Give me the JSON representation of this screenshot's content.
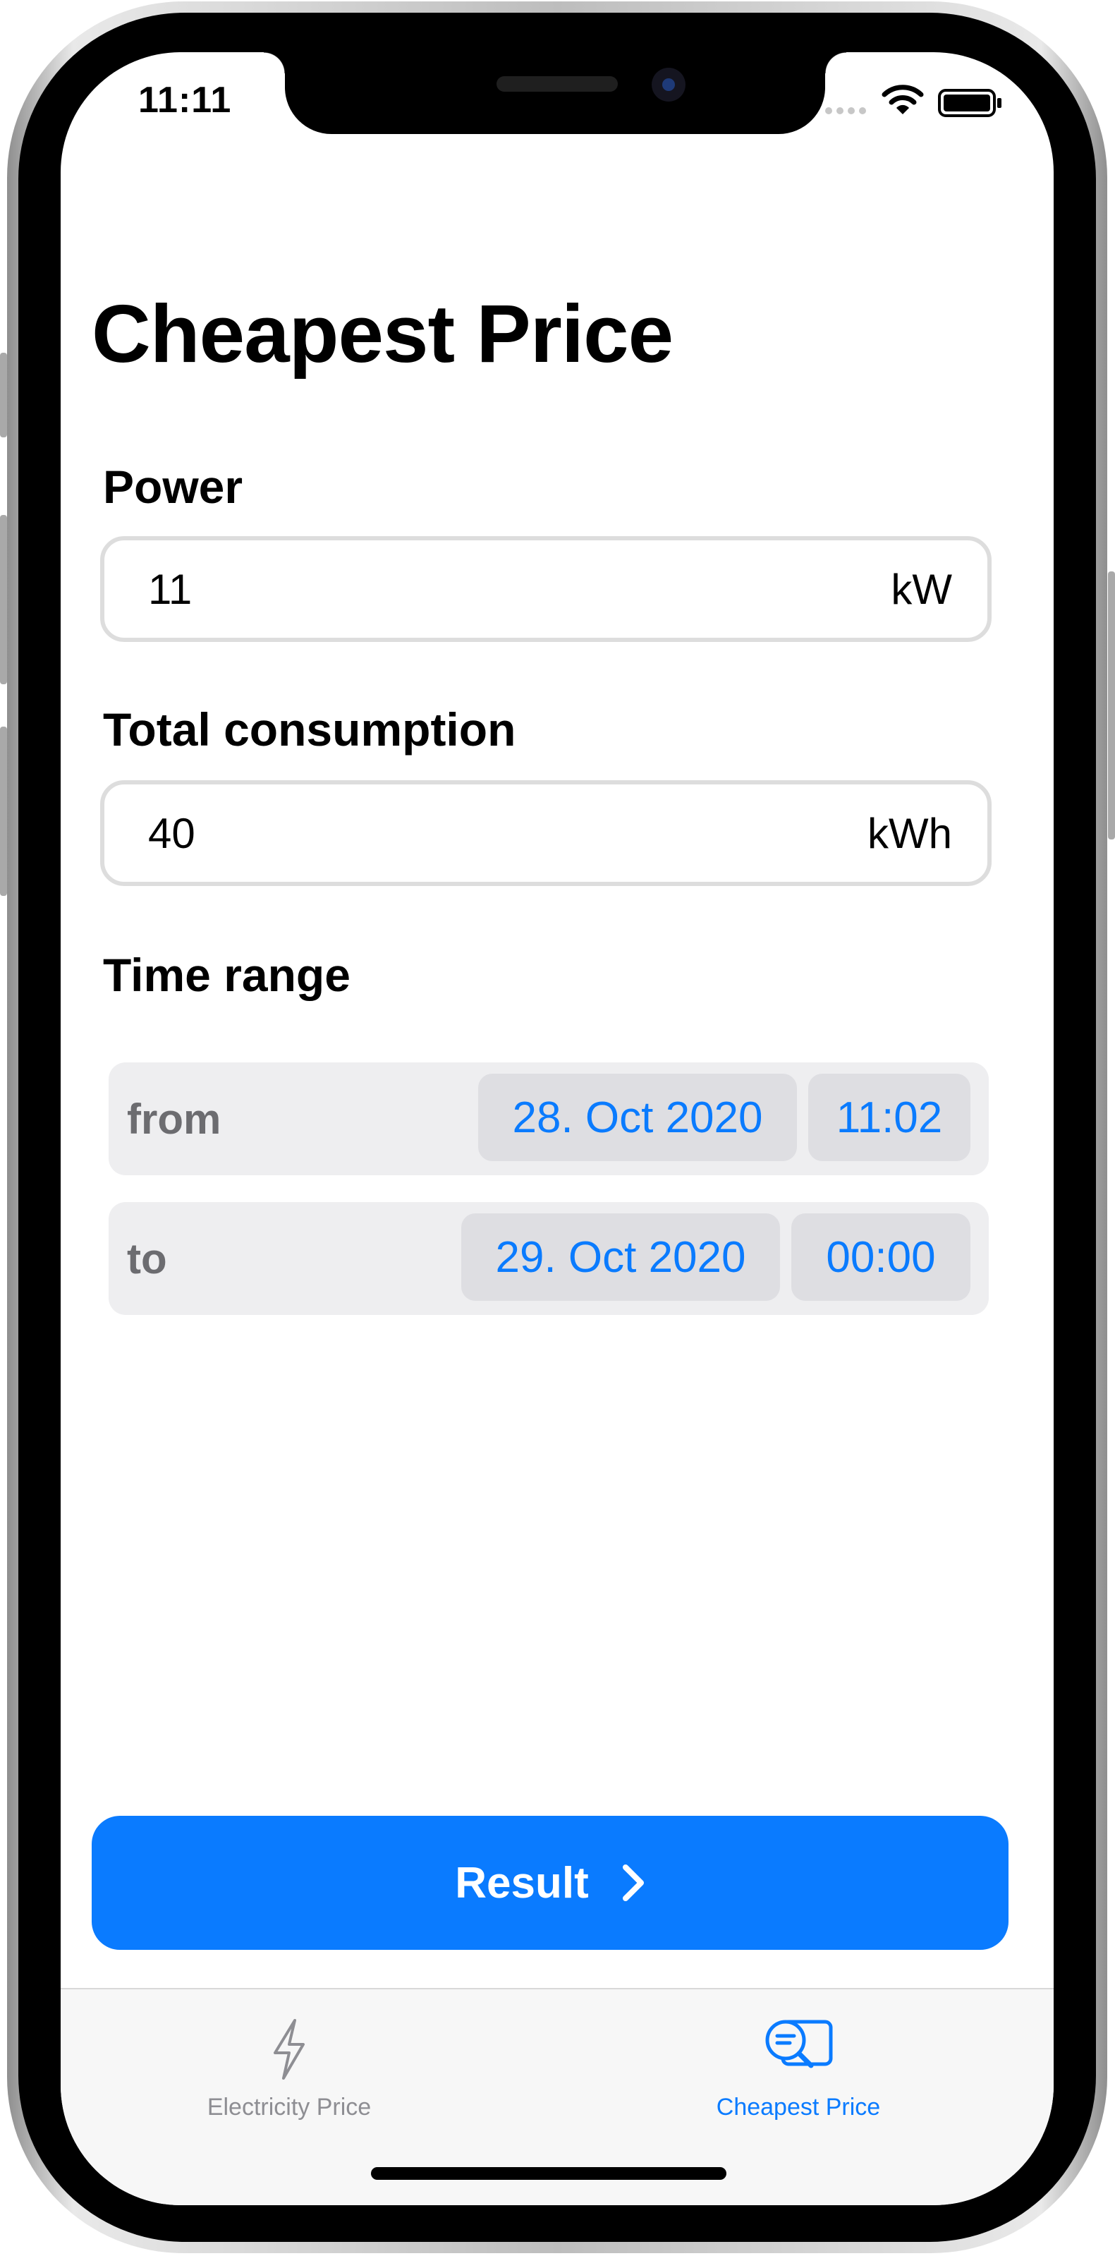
{
  "status_bar": {
    "time": "11:11"
  },
  "page": {
    "title": "Cheapest Price"
  },
  "power": {
    "label": "Power",
    "value": "11",
    "unit": "kW"
  },
  "consumption": {
    "label": "Total consumption",
    "value": "40",
    "unit": "kWh"
  },
  "time_range": {
    "label": "Time range",
    "from": {
      "label": "from",
      "date": "28. Oct 2020",
      "time": "11:02"
    },
    "to": {
      "label": "to",
      "date": "29. Oct 2020",
      "time": "00:00"
    }
  },
  "result_button": {
    "label": "Result"
  },
  "tab_bar": {
    "tabs": [
      {
        "label": "Electricity Price",
        "icon": "bolt-icon",
        "selected": false
      },
      {
        "label": "Cheapest Price",
        "icon": "magnifier-list-icon",
        "selected": true
      }
    ]
  },
  "colors": {
    "accent": "#0A7BFF",
    "inactive_tab": "#8E8E93"
  }
}
